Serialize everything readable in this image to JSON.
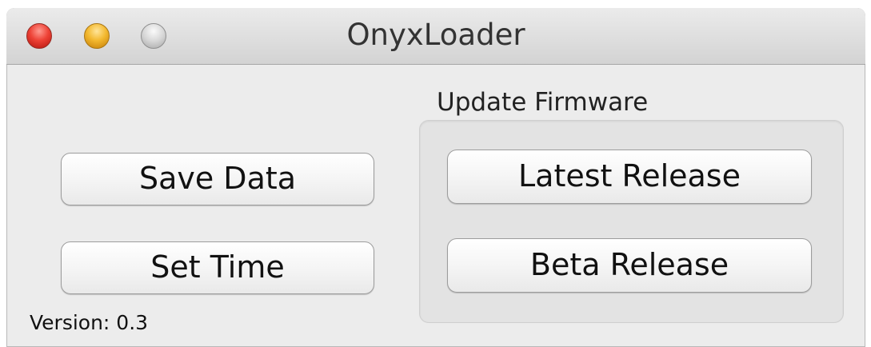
{
  "window": {
    "title": "OnyxLoader"
  },
  "buttons": {
    "save_data": "Save Data",
    "set_time": "Set Time",
    "latest_release": "Latest Release",
    "beta_release": "Beta Release"
  },
  "firmware_group": {
    "label": "Update Firmware"
  },
  "footer": {
    "version": "Version: 0.3"
  },
  "icons": {
    "close": "close-button",
    "minimize": "minimize-button",
    "zoom": "zoom-button"
  },
  "colors": {
    "close": "#ee4236",
    "minimize": "#f3b930",
    "zoom": "#d6d6d6"
  }
}
